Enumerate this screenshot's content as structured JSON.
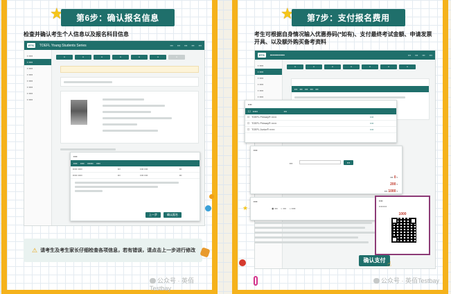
{
  "left": {
    "step_title": "第6步：确认报名信息",
    "description": "检查并确认考生个人信息以及报名科目信息",
    "app_title": "TOEFL Young Students Series",
    "notice": "请考生及考生家长仔细检查各项信息，若有错误，请点击上一步进行修改",
    "watermark": "公众号 · 英佰Testbay",
    "bottom_buttons": [
      "上一步",
      "确认报名"
    ]
  },
  "right": {
    "step_title": "第7步：支付报名费用",
    "description": "考生可根据自身情况输入优惠券码(*如有)、支付最终考试金额、申请发票开具、以及额外购买备考资料",
    "pay_button": "确认支付",
    "watermark": "公众号 · 英佰Testbay",
    "amounts": [
      "0",
      "200",
      "1000"
    ],
    "qr_amount": "1000"
  },
  "colors": {
    "accent": "#1f6f6b",
    "border": "#f5b21b",
    "qr_frame": "#8c3a76"
  }
}
